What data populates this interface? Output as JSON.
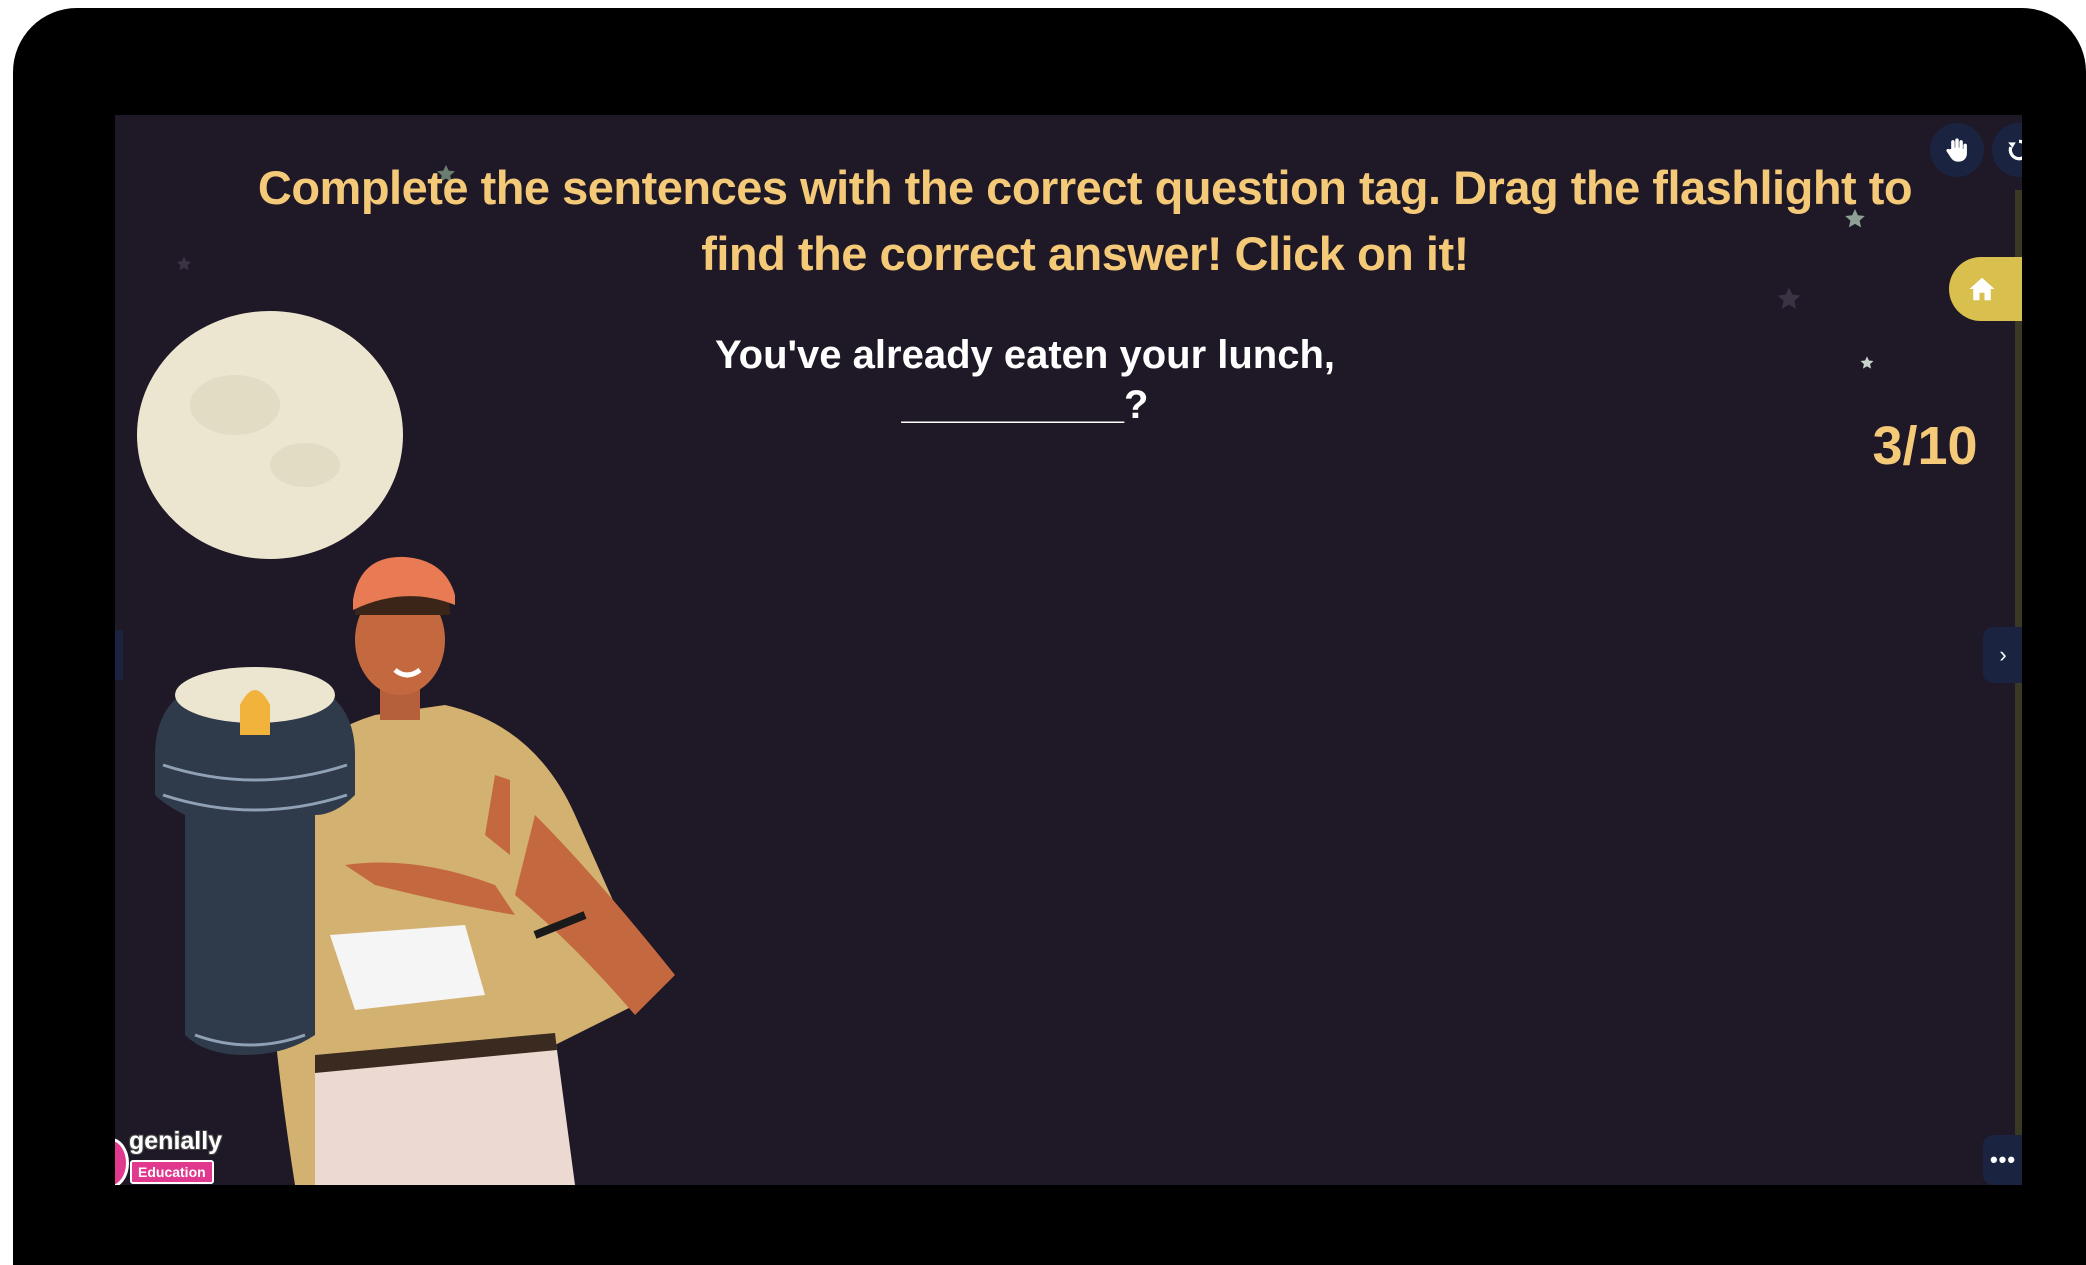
{
  "instruction": "Complete the sentences with the correct question tag. Drag the flashlight to find the correct answer! Click on it!",
  "question": "You've already eaten your lunch, __________?",
  "progress": "3/10",
  "controls": {
    "hand_icon": "hand-icon",
    "rotate_icon": "rotate-icon",
    "home_icon": "home-icon",
    "next_icon": "chevron-right-icon",
    "next_glyph": "›",
    "more_glyph": "•••"
  },
  "branding": {
    "logo_word": "genially",
    "badge": "Education"
  },
  "colors": {
    "background": "#1f1826",
    "accent": "#f4c978",
    "home_button": "#d9c04e",
    "control_button": "#1a2440"
  }
}
